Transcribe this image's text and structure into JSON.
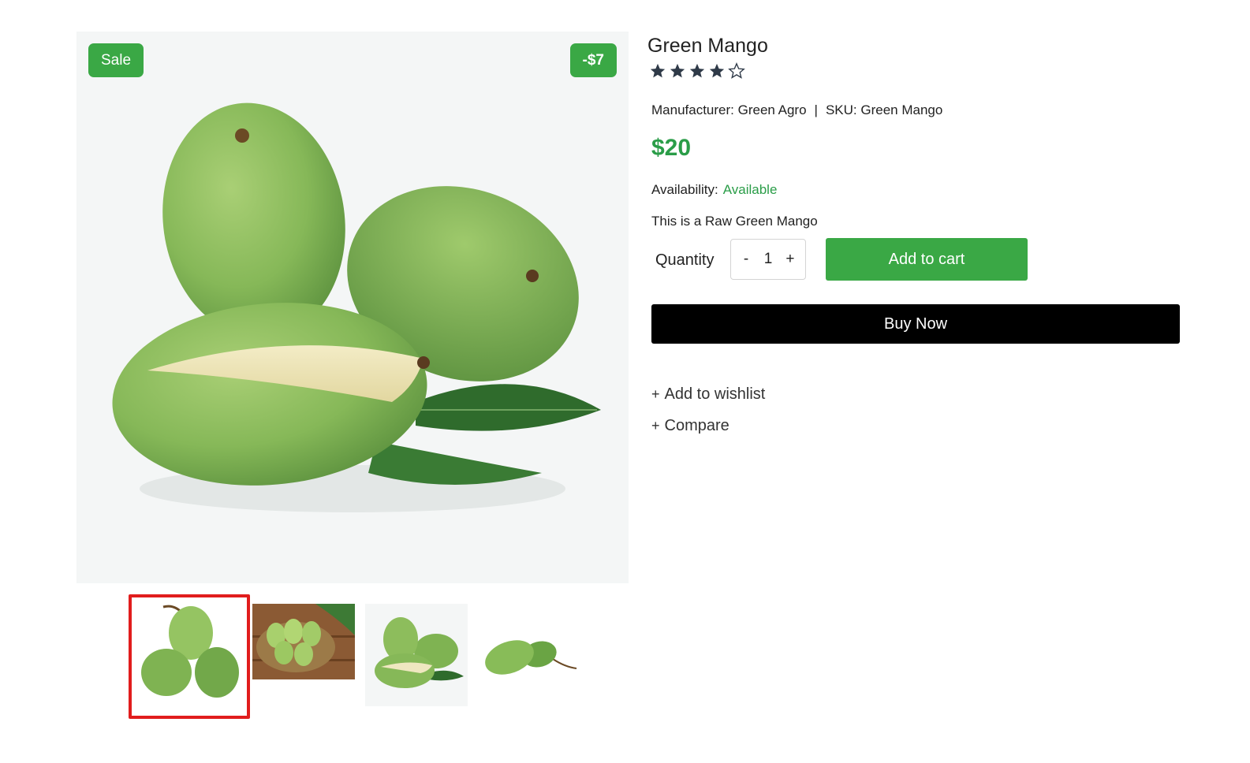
{
  "gallery": {
    "sale_badge": "Sale",
    "discount_badge": "-$7",
    "main_image_alt": "green-mango-image",
    "thumbnails": [
      {
        "icon": "mango-trio-thumbnail",
        "selected": true
      },
      {
        "icon": "mango-basket-thumbnail",
        "selected": false
      },
      {
        "icon": "cut-mango-thumbnail",
        "selected": false
      },
      {
        "icon": "mango-pair-thumbnail",
        "selected": false
      }
    ]
  },
  "product": {
    "title": "Green Mango",
    "rating": 4,
    "rating_max": 5,
    "manufacturer": "Manufacturer: Green Agro",
    "separator": "|",
    "sku": "SKU: Green Mango",
    "price": "$20",
    "availability_label": "Availability:",
    "availability_value": "Available",
    "description": "This is a Raw Green Mango"
  },
  "purchase": {
    "quantity_label": "Quantity",
    "minus": "-",
    "quantity": "1",
    "plus": "+",
    "add_to_cart": "Add to cart",
    "buy_now": "Buy Now"
  },
  "actions": {
    "plus_icon": "+",
    "wishlist": "Add to wishlist",
    "compare": "Compare"
  },
  "colors": {
    "accent": "#3aa845",
    "price": "#2a9d48",
    "selected_thumb_border": "#e11d1d",
    "buy_now_bg": "#000000",
    "star": "#2f3a48"
  }
}
